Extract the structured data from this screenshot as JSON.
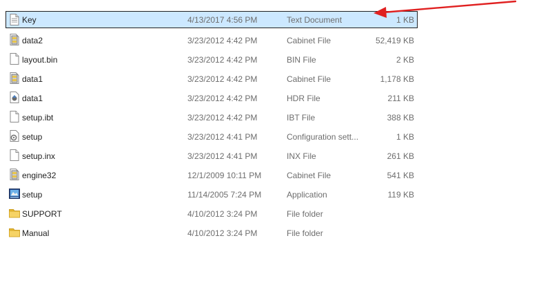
{
  "files": [
    {
      "name": "Key",
      "date": "4/13/2017 4:56 PM",
      "type": "Text Document",
      "size": "1 KB",
      "icon": "text-document-icon",
      "selected": true
    },
    {
      "name": "data2",
      "date": "3/23/2012 4:42 PM",
      "type": "Cabinet File",
      "size": "52,419 KB",
      "icon": "cabinet-file-icon",
      "selected": false
    },
    {
      "name": "layout.bin",
      "date": "3/23/2012 4:42 PM",
      "type": "BIN File",
      "size": "2 KB",
      "icon": "blank-file-icon",
      "selected": false
    },
    {
      "name": "data1",
      "date": "3/23/2012 4:42 PM",
      "type": "Cabinet File",
      "size": "1,178 KB",
      "icon": "cabinet-file-icon",
      "selected": false
    },
    {
      "name": "data1",
      "date": "3/23/2012 4:42 PM",
      "type": "HDR File",
      "size": "211 KB",
      "icon": "hdr-file-icon",
      "selected": false
    },
    {
      "name": "setup.ibt",
      "date": "3/23/2012 4:42 PM",
      "type": "IBT File",
      "size": "388 KB",
      "icon": "blank-file-icon",
      "selected": false
    },
    {
      "name": "setup",
      "date": "3/23/2012 4:41 PM",
      "type": "Configuration sett...",
      "size": "1 KB",
      "icon": "config-file-icon",
      "selected": false
    },
    {
      "name": "setup.inx",
      "date": "3/23/2012 4:41 PM",
      "type": "INX File",
      "size": "261 KB",
      "icon": "blank-file-icon",
      "selected": false
    },
    {
      "name": "engine32",
      "date": "12/1/2009 10:11 PM",
      "type": "Cabinet File",
      "size": "541 KB",
      "icon": "cabinet-file-icon",
      "selected": false
    },
    {
      "name": "setup",
      "date": "11/14/2005 7:24 PM",
      "type": "Application",
      "size": "119 KB",
      "icon": "application-icon",
      "selected": false
    },
    {
      "name": "SUPPORT",
      "date": "4/10/2012 3:24 PM",
      "type": "File folder",
      "size": "",
      "icon": "folder-icon",
      "selected": false
    },
    {
      "name": "Manual",
      "date": "4/10/2012 3:24 PM",
      "type": "File folder",
      "size": "",
      "icon": "folder-icon",
      "selected": false
    }
  ],
  "colors": {
    "selection_bg": "#cce8ff",
    "annotation_arrow": "#e02020",
    "folder": "#f4c542"
  }
}
